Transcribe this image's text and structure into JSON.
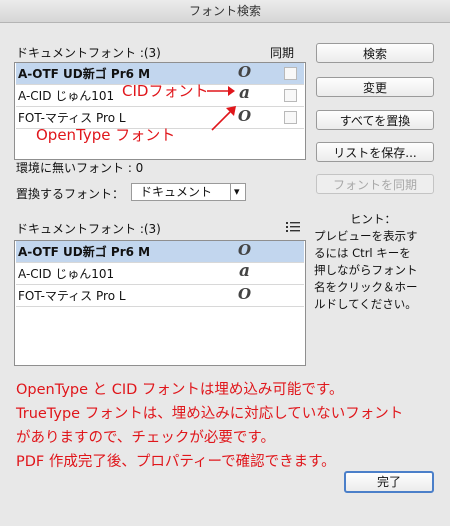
{
  "window": {
    "title": "フォント検索"
  },
  "doc_fonts_top": {
    "header": "ドキュメントフォント :(3)",
    "sync_header": "同期",
    "rows": [
      {
        "name": "A-OTF UD新ゴ Pr6 M",
        "icon": "opentype-icon",
        "glyph": "O",
        "selected": true,
        "synced": false
      },
      {
        "name": "A-CID じゅん101",
        "icon": "cid-icon",
        "glyph": "a",
        "selected": false,
        "synced": false
      },
      {
        "name": "FOT-マティス Pro L",
        "icon": "opentype-icon",
        "glyph": "O",
        "selected": false,
        "synced": false
      }
    ]
  },
  "annotations": {
    "cid_label": "CIDフォント",
    "opentype_label": "OpenType フォント"
  },
  "missing_fonts": "環境に無いフォント : 0",
  "replace": {
    "label": "置換するフォント：",
    "value": "ドキュメント",
    "arrow": "▾"
  },
  "doc_fonts_bottom": {
    "header": "ドキュメントフォント :(3)",
    "rows": [
      {
        "name": "A-OTF UD新ゴ Pr6 M",
        "glyph": "O",
        "selected": true
      },
      {
        "name": "A-CID じゅん101",
        "glyph": "a",
        "selected": false
      },
      {
        "name": "FOT-マティス Pro L",
        "glyph": "O",
        "selected": false
      }
    ]
  },
  "buttons": {
    "search": "検索",
    "change": "変更",
    "replace_all": "すべてを置換",
    "save_list": "リストを保存...",
    "sync_fonts": "フォントを同期",
    "done": "完了"
  },
  "hint": {
    "title": "ヒント：",
    "body_l1": "プレビューを表示す",
    "body_l2": "るには Ctrl キーを",
    "body_l3": "押しながらフォント",
    "body_l4": "名をクリック＆ホー",
    "body_l5": "ルドしてください。"
  },
  "note": {
    "line1": "OpenType と CID フォントは埋め込み可能です。",
    "line2": "TrueType フォントは、埋め込みに対応していないフォント",
    "line3": "がありますので、チェックが必要です。",
    "line4": "PDF 作成完了後、プロパティーで確認できます。"
  },
  "colors": {
    "annotation_red": "#e0161b",
    "selection": "#c2d6ee",
    "default_button_border": "#4b7fc9"
  }
}
